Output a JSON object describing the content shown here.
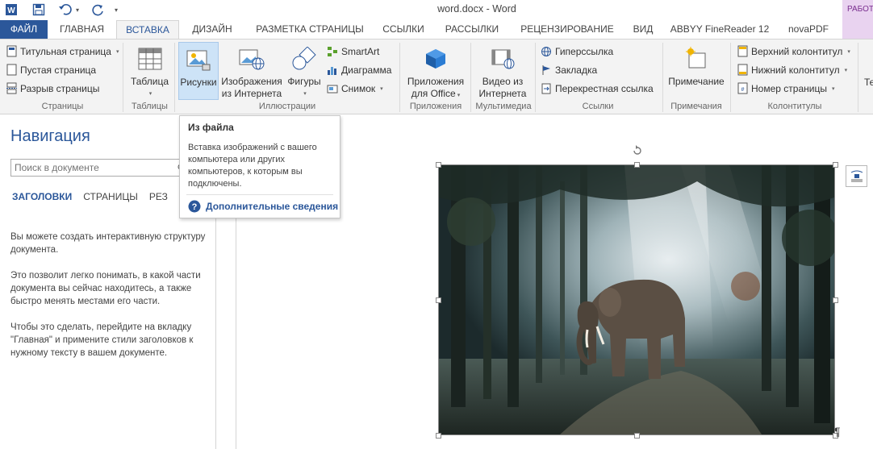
{
  "title": "word.docx - Word",
  "context_tab": "РАБОТА",
  "tabs": [
    "ФАЙЛ",
    "ГЛАВНАЯ",
    "ВСТАВКА",
    "ДИЗАЙН",
    "РАЗМЕТКА СТРАНИЦЫ",
    "ССЫЛКИ",
    "РАССЫЛКИ",
    "РЕЦЕНЗИРОВАНИЕ",
    "ВИД",
    "ABBYY FineReader 12",
    "novaPDF"
  ],
  "active_tab": "ВСТАВКА",
  "ribbon": {
    "pages": {
      "title_page": "Титульная страница",
      "blank_page": "Пустая страница",
      "page_break": "Разрыв страницы",
      "label": "Страницы"
    },
    "tables": {
      "table": "Таблица",
      "label": "Таблицы"
    },
    "illustrations": {
      "pictures": "Рисунки",
      "online_pictures_1": "Изображения",
      "online_pictures_2": "из Интернета",
      "shapes": "Фигуры",
      "smartart": "SmartArt",
      "chart": "Диаграмма",
      "screenshot": "Снимок",
      "label": "Иллюстрации"
    },
    "apps": {
      "apps_1": "Приложения",
      "apps_2": "для Office",
      "label": "Приложения"
    },
    "media": {
      "video_1": "Видео из",
      "video_2": "Интернета",
      "label": "Мультимедиа"
    },
    "links": {
      "hyperlink": "Гиперссылка",
      "bookmark": "Закладка",
      "cross_ref": "Перекрестная ссылка",
      "label": "Ссылки"
    },
    "comments": {
      "comment": "Примечание",
      "label": "Примечания"
    },
    "header_footer": {
      "header": "Верхний колонтитул",
      "footer": "Нижний колонтитул",
      "page_number": "Номер страницы",
      "label": "Колонтитулы"
    },
    "cut_text": "Те"
  },
  "tooltip": {
    "title": "Из файла",
    "body": "Вставка изображений с вашего компьютера или других компьютеров, к которым вы подключены.",
    "more": "Дополнительные сведения"
  },
  "nav": {
    "title": "Навигация",
    "search_placeholder": "Поиск в документе",
    "tabs": [
      "ЗАГОЛОВКИ",
      "СТРАНИЦЫ",
      "РЕЗ"
    ],
    "paragraphs": [
      "Вы можете создать интерактивную структуру документа.",
      "Это позволит легко понимать, в какой части документа вы сейчас находитесь, а также быстро менять местами его части.",
      "Чтобы это сделать, перейдите на вкладку \"Главная\" и примените стили заголовков к нужному тексту в вашем документе."
    ]
  },
  "colors": {
    "accent": "#2b579a",
    "ribbon_bg": "#f3f3f3",
    "context": "#e9d3f0"
  },
  "image": {
    "subject": "elephant-forest-photo"
  },
  "pilcrow": "¶"
}
